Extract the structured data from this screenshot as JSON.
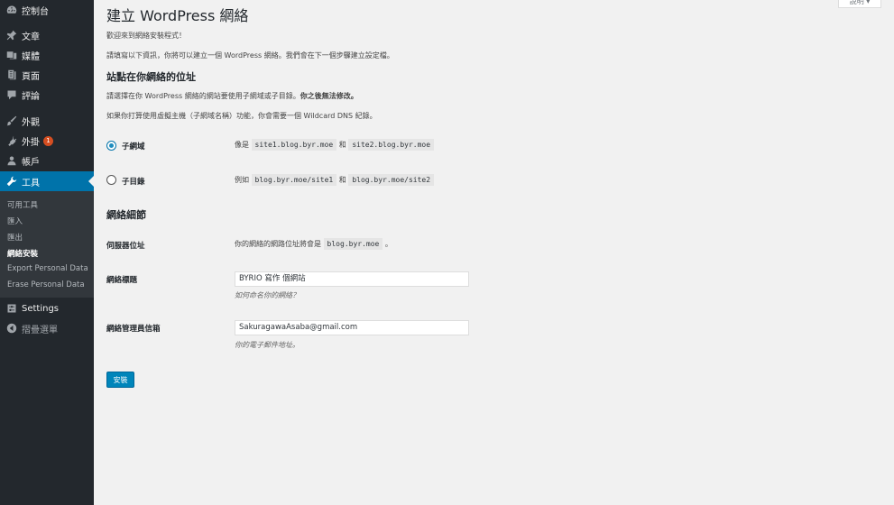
{
  "sidebar": {
    "items": [
      {
        "label": "控制台",
        "icon": "dashboard-icon"
      },
      {
        "label": "文章",
        "icon": "pushpin-icon"
      },
      {
        "label": "媒體",
        "icon": "media-icon"
      },
      {
        "label": "頁面",
        "icon": "page-icon"
      },
      {
        "label": "評論",
        "icon": "comment-icon"
      },
      {
        "label": "外觀",
        "icon": "brush-icon"
      },
      {
        "label": "外掛",
        "icon": "plugin-icon",
        "badge": "1"
      },
      {
        "label": "帳戶",
        "icon": "user-icon"
      },
      {
        "label": "工具",
        "icon": "wrench-icon"
      },
      {
        "label": "Settings",
        "icon": "settings-icon"
      },
      {
        "label": "摺疊選單",
        "icon": "collapse-icon"
      }
    ],
    "submenu": [
      "可用工具",
      "匯入",
      "匯出",
      "網絡安裝",
      "Export Personal Data",
      "Erase Personal Data"
    ]
  },
  "header": {
    "help_label": "說明 ▾"
  },
  "page": {
    "title": "建立 WordPress 網絡",
    "intro1": "歡迎來到網絡安裝程式！",
    "intro2": "請填寫以下資訊，你將可以建立一個 WordPress 網絡。我們會在下一個步驟建立設定檔。",
    "section1_title": "站點在你網絡的位址",
    "section1_p1_a": "請選擇在你 WordPress 網絡的網站要使用子網域或子目錄。",
    "section1_p1_b": "你之後無法修改。",
    "section1_p2": "如果你打算使用虛擬主機（子網域名稱）功能，你會需要一個 Wildcard DNS 紀錄。",
    "subdomain": {
      "label": "子網域",
      "prefix": "像是",
      "ex1": "site1.blog.byr.moe",
      "and": "和",
      "ex2": "site2.blog.byr.moe"
    },
    "subdir": {
      "label": "子目錄",
      "prefix": "例如",
      "ex1": "blog.byr.moe/site1",
      "and": "和",
      "ex2": "blog.byr.moe/site2"
    },
    "section2_title": "網絡細節",
    "server": {
      "label": "伺服器位址",
      "prefix": "你的網絡的網路位址將會是",
      "value": "blog.byr.moe",
      "suffix": "。"
    },
    "network_title": {
      "label": "網絡標題",
      "value": "BYRIO 寫作 個網站",
      "desc": "如何命名你的網絡？"
    },
    "admin_email": {
      "label": "網絡管理員信箱",
      "value": "SakuragawaAsaba@gmail.com",
      "desc": "你的電子郵件地址。"
    },
    "install_button": "安裝"
  }
}
